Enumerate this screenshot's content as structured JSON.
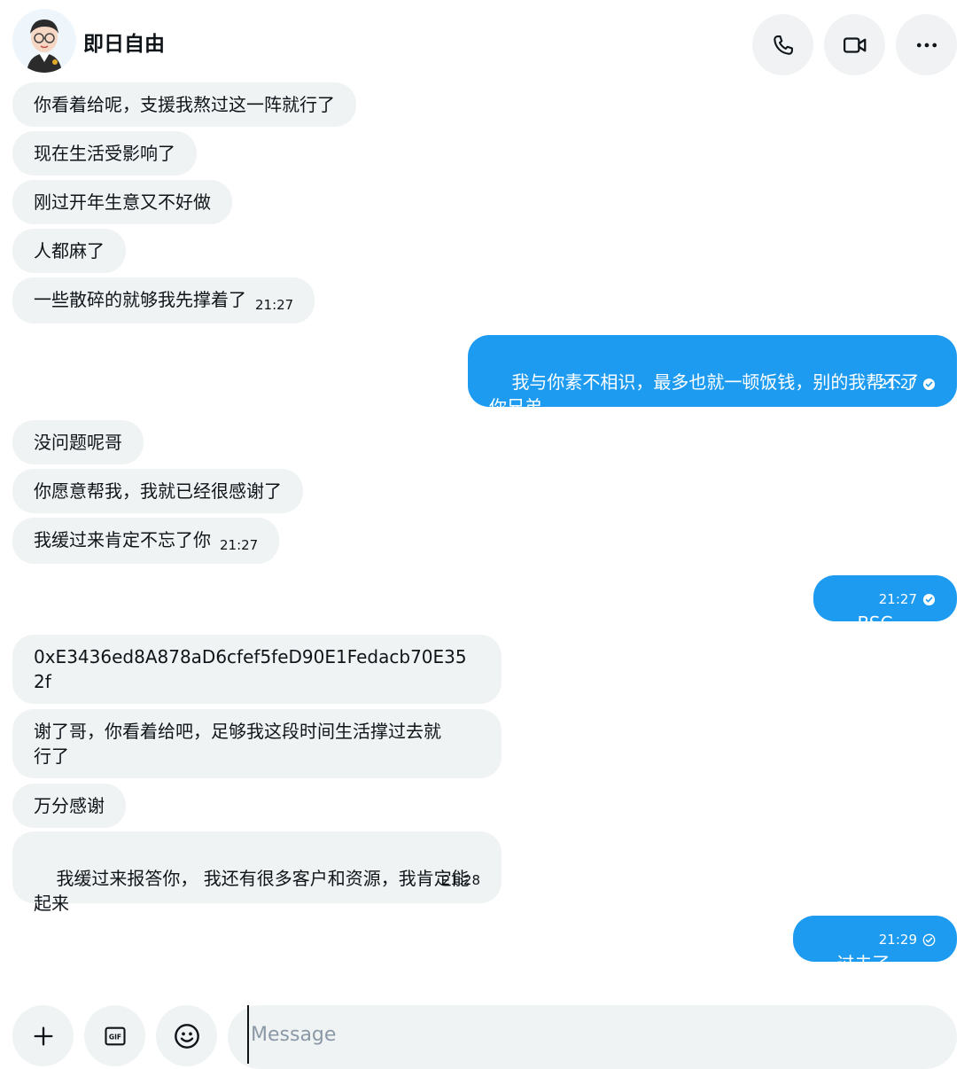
{
  "header": {
    "contact_name": "即日自由"
  },
  "messages": [
    {
      "dir": "in",
      "text": "你看着给呢，支援我熬过这一阵就行了",
      "time": ""
    },
    {
      "dir": "in",
      "text": "现在生活受影响了",
      "time": ""
    },
    {
      "dir": "in",
      "text": "刚过开年生意又不好做",
      "time": ""
    },
    {
      "dir": "in",
      "text": "人都麻了",
      "time": ""
    },
    {
      "dir": "in",
      "text": "一些散碎的就够我先撑着了",
      "time": "21:27"
    },
    {
      "dir": "out",
      "text": "我与你素不相识，最多也就一顿饭钱，别的我帮不了\n你兄弟。",
      "time": "21:27",
      "status": "read"
    },
    {
      "dir": "in",
      "text": "没问题呢哥",
      "time": ""
    },
    {
      "dir": "in",
      "text": "你愿意帮我，我就已经很感谢了",
      "time": ""
    },
    {
      "dir": "in",
      "text": "我缓过来肯定不忘了你",
      "time": "21:27"
    },
    {
      "dir": "out",
      "text": "BSC",
      "time": "21:27",
      "status": "read"
    },
    {
      "dir": "in",
      "text": "0xE3436ed8A878aD6cfef5feD90E1Fedacb70E35\n2f",
      "time": ""
    },
    {
      "dir": "in",
      "text": "谢了哥，你看着给吧，足够我这段时间生活撑过去就\n行了",
      "time": ""
    },
    {
      "dir": "in",
      "text": "万分感谢",
      "time": ""
    },
    {
      "dir": "in",
      "text": "我缓过来报答你， 我还有很多客户和资源，我肯定能\n起来",
      "time": "21:28"
    },
    {
      "dir": "out",
      "text": "过去了",
      "time": "21:29",
      "status": "sent"
    }
  ],
  "composer": {
    "placeholder": "Message"
  },
  "icons": {
    "call": "phone-icon",
    "video": "video-camera-icon",
    "more": "more-horizontal-icon",
    "add": "plus-icon",
    "gif": "gif-icon",
    "emoji": "emoji-icon",
    "read": "check-circle-filled-icon",
    "sent": "check-circle-outline-icon"
  },
  "colors": {
    "outgoing_bubble": "#1d9bf0",
    "incoming_bubble": "#eff3f4",
    "text": "#0f1419"
  }
}
